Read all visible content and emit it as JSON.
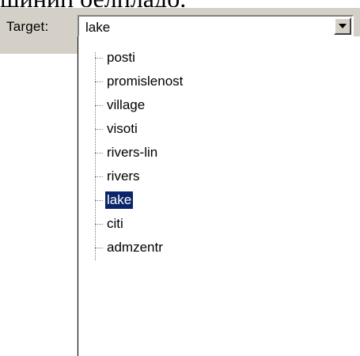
{
  "background": {
    "cut_text": "шинип оелпладо."
  },
  "toolbar": {
    "label": "Target:"
  },
  "combo": {
    "value": "lake",
    "button_icon": "chevron-down-icon"
  },
  "tree": {
    "items": [
      {
        "label": "posti",
        "selected": false
      },
      {
        "label": "promislenost",
        "selected": false
      },
      {
        "label": "village",
        "selected": false
      },
      {
        "label": "visoti",
        "selected": false
      },
      {
        "label": "rivers-lin",
        "selected": false
      },
      {
        "label": "rivers",
        "selected": false
      },
      {
        "label": "lake",
        "selected": true
      },
      {
        "label": "citi",
        "selected": false
      },
      {
        "label": "admzentr",
        "selected": false
      }
    ]
  },
  "colors": {
    "toolbar_bg": "#d4d0c8",
    "selection_bg": "#0a246a",
    "selection_text": "#ffffff"
  }
}
